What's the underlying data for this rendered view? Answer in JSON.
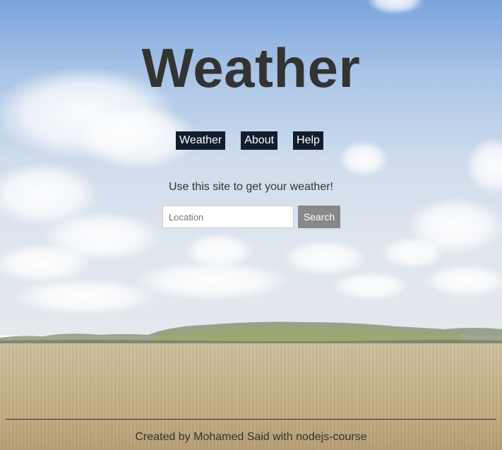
{
  "header": {
    "title": "Weather"
  },
  "nav": {
    "items": [
      {
        "label": "Weather"
      },
      {
        "label": "About"
      },
      {
        "label": "Help"
      }
    ]
  },
  "main": {
    "tagline": "Use this site to get your weather!",
    "search": {
      "placeholder": "Location",
      "value": "",
      "button_label": "Search"
    }
  },
  "footer": {
    "text": "Created by Mohamed Said with nodejs-course"
  },
  "colors": {
    "title": "#333333",
    "nav_background": "#111d2e",
    "nav_text": "#ffffff",
    "search_button": "#888888"
  }
}
